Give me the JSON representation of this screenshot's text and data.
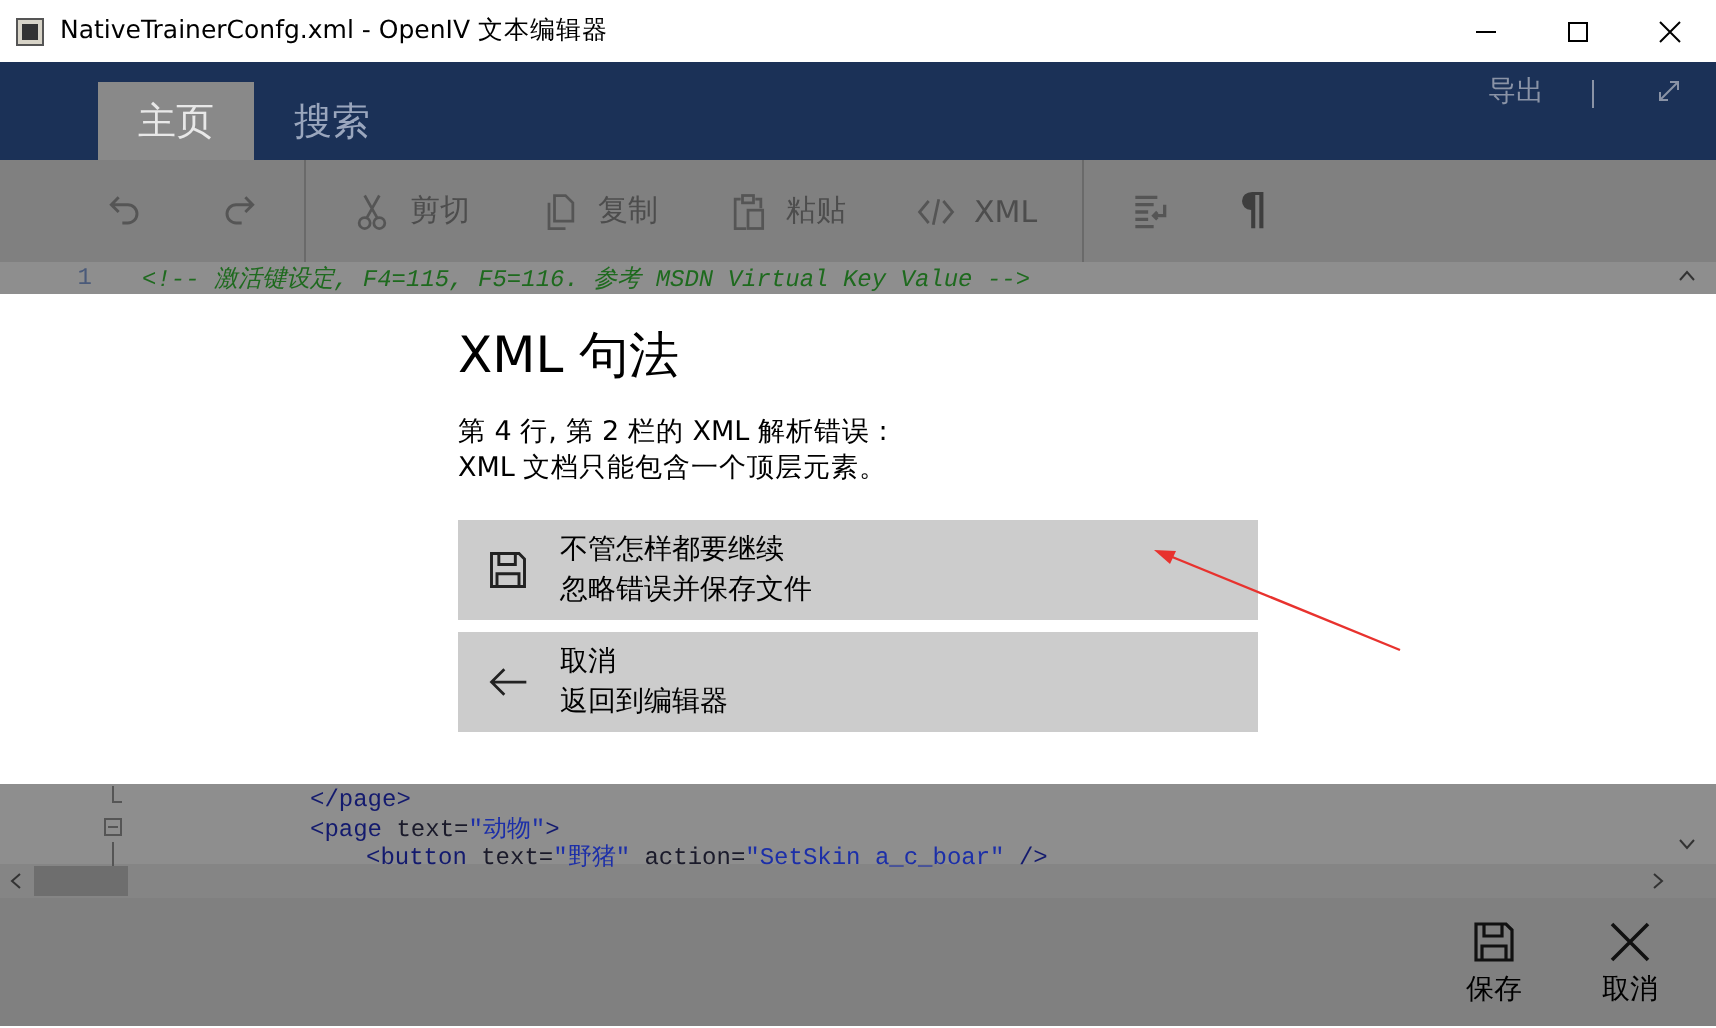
{
  "window": {
    "title": "NativeTrainerConfg.xml - OpenIV 文本编辑器"
  },
  "header": {
    "tabs": [
      {
        "label": "主页",
        "selected": true
      },
      {
        "label": "搜索",
        "selected": false
      }
    ],
    "export_label": "导出"
  },
  "toolbar": {
    "groups": [
      [
        {
          "kind": "undo"
        },
        {
          "kind": "redo"
        }
      ],
      [
        {
          "kind": "cut",
          "label": "剪切"
        },
        {
          "kind": "copy",
          "label": "复制"
        },
        {
          "kind": "paste",
          "label": "粘贴"
        },
        {
          "kind": "xml",
          "label": "XML"
        }
      ],
      [
        {
          "kind": "format"
        },
        {
          "kind": "glyph",
          "label": "¶"
        }
      ]
    ]
  },
  "editor": {
    "lines_before": [
      {
        "number": "1",
        "tokens": [
          {
            "kind": "comment",
            "text": "<!-- 激活键设定, F4=115, F5=116. 参考 MSDN Virtual Key Value -->"
          }
        ]
      }
    ],
    "lines_after": [
      {
        "kind": "fold_end",
        "tokens": [
          {
            "kind": "tag",
            "text": "</page>"
          }
        ]
      },
      {
        "kind": "fold_open",
        "tokens": [
          {
            "kind": "tag",
            "text": "<page "
          },
          {
            "kind": "attr",
            "text": "text="
          },
          {
            "kind": "value",
            "text": "\"动物\""
          },
          {
            "kind": "tag",
            "text": ">"
          }
        ],
        "children": [
          {
            "kind": "fold_line",
            "tokens": [
              {
                "kind": "tag",
                "text": "<button "
              },
              {
                "kind": "attr",
                "text": "text="
              },
              {
                "kind": "value",
                "text": "\"野猪\""
              },
              {
                "kind": "attr",
                "text": " action="
              },
              {
                "kind": "value",
                "text": "\"SetSkin a_c_boar\""
              },
              {
                "kind": "tag",
                "text": " />"
              }
            ]
          }
        ]
      }
    ]
  },
  "dialog": {
    "title": "XML 句法",
    "message": [
      "第 4 行, 第 2 栏的 XML 解析错误 :",
      "XML 文档只能包含一个顶层元素。"
    ],
    "options": [
      {
        "kind": "save",
        "title": "不管怎样都要继续",
        "subtitle": "忽略错误并保存文件"
      },
      {
        "kind": "back",
        "title": "取消",
        "subtitle": "返回到编辑器"
      }
    ]
  },
  "footer": {
    "buttons": [
      {
        "kind": "save",
        "label": "保存"
      },
      {
        "kind": "cancel",
        "label": "取消"
      }
    ]
  }
}
